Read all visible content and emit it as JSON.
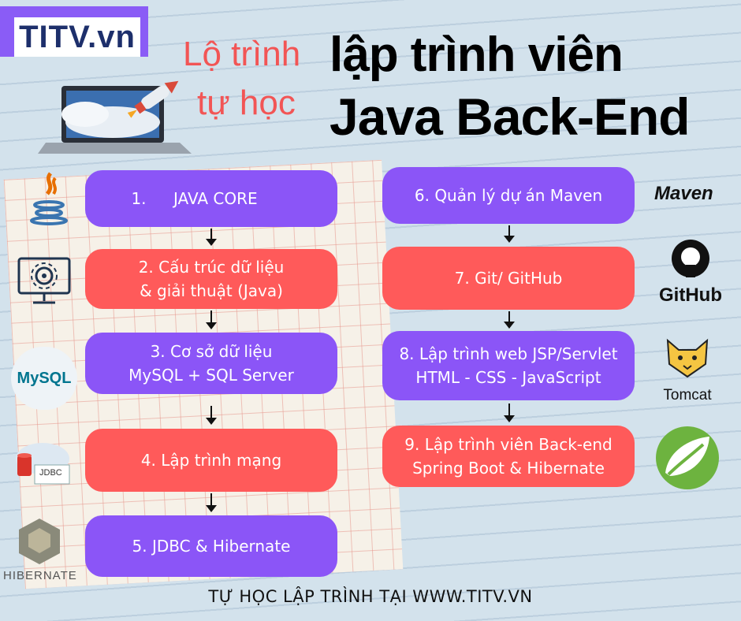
{
  "brand": {
    "logo_text": "TITV.vn"
  },
  "title": {
    "sub_line1": "Lộ trình",
    "sub_line2": "tự học",
    "main_line1": "lập trình viên",
    "main_line2": "Java Back-End"
  },
  "steps": [
    {
      "line1": "1.",
      "line2": "JAVA CORE"
    },
    {
      "line1": "2. Cấu trúc dữ liệu",
      "line2": "& giải thuật (Java)"
    },
    {
      "line1": "3. Cơ sở dữ liệu",
      "line2": "MySQL + SQL Server"
    },
    {
      "line1": "4. Lập trình mạng"
    },
    {
      "line1": "5. JDBC & Hibernate"
    },
    {
      "line1": "6. Quản lý dự án Maven"
    },
    {
      "line1": "7. Git/ GitHub"
    },
    {
      "line1": "8. Lập trình web JSP/Servlet",
      "line2": "HTML - CSS - JavaScript"
    },
    {
      "line1": "9. Lập trình viên Back-end",
      "line2": "Spring Boot & Hibernate"
    }
  ],
  "logos": {
    "mysql": "MySQL",
    "jdbc": "JDBC",
    "hibernate": "HIBERNATE",
    "maven": "Maven",
    "github": "GitHub",
    "tomcat": "Tomcat"
  },
  "footer": "TỰ HỌC LẬP TRÌNH TẠI WWW.TITV.VN",
  "colors": {
    "purple": "#8b55f7",
    "red": "#ff5a5a",
    "title_red": "#f25555"
  }
}
